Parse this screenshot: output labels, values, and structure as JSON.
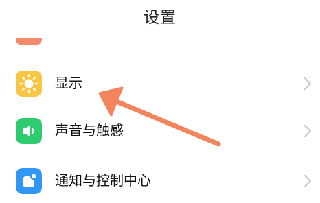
{
  "header": {
    "title": "设置"
  },
  "settings": {
    "items": [
      {
        "label": "显示",
        "icon": "sun-icon",
        "icon_color": "#F9C644"
      },
      {
        "label": "声音与触感",
        "icon": "speaker-icon",
        "icon_color": "#2ECC71"
      },
      {
        "label": "通知与控制中心",
        "icon": "notification-icon",
        "icon_color": "#3296F5"
      }
    ],
    "partial_icon_color": "#F58A6A"
  },
  "annotation": {
    "arrow_color": "#F2855E",
    "points_to": "显示"
  }
}
